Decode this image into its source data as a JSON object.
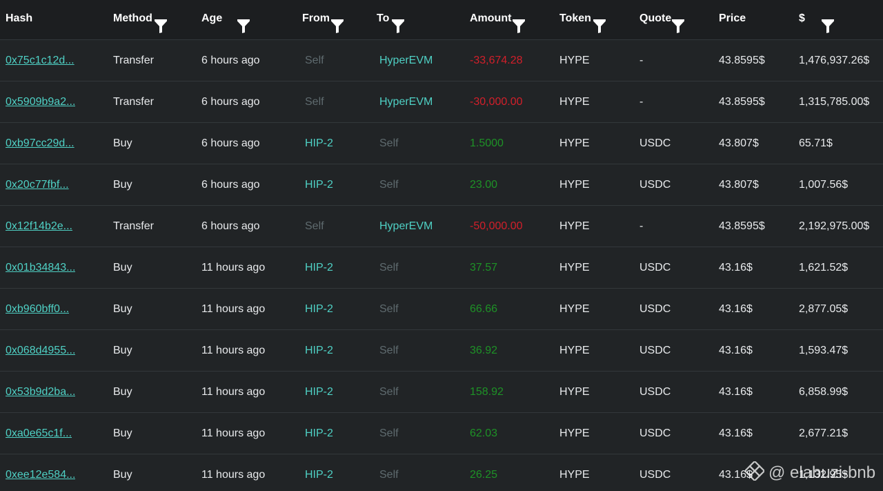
{
  "columns": {
    "hash": "Hash",
    "method": "Method",
    "age": "Age",
    "from": "From",
    "to": "To",
    "amount": "Amount",
    "token": "Token",
    "quote": "Quote",
    "price": "Price",
    "usd": "$"
  },
  "icons": {
    "filter": "filter-funnel-icon",
    "watermark_logo": "binance-diamond-icon"
  },
  "colors": {
    "link": "#4fd1c5",
    "negative": "#d21f2a",
    "positive": "#1e9226",
    "muted": "#5f6b6f"
  },
  "rows": [
    {
      "hash": "0x75c1c12d...",
      "method": "Transfer",
      "age": "6 hours ago",
      "from": "Self",
      "to": "HyperEVM",
      "amount": "-33,674.28",
      "token": "HYPE",
      "quote": "-",
      "price": "43.8595$",
      "usd": "1,476,937.26$"
    },
    {
      "hash": "0x5909b9a2...",
      "method": "Transfer",
      "age": "6 hours ago",
      "from": "Self",
      "to": "HyperEVM",
      "amount": "-30,000.00",
      "token": "HYPE",
      "quote": "-",
      "price": "43.8595$",
      "usd": "1,315,785.00$"
    },
    {
      "hash": "0xb97cc29d...",
      "method": "Buy",
      "age": "6 hours ago",
      "from": "HIP-2",
      "to": "Self",
      "amount": "1.5000",
      "token": "HYPE",
      "quote": "USDC",
      "price": "43.807$",
      "usd": "65.71$"
    },
    {
      "hash": "0x20c77fbf...",
      "method": "Buy",
      "age": "6 hours ago",
      "from": "HIP-2",
      "to": "Self",
      "amount": "23.00",
      "token": "HYPE",
      "quote": "USDC",
      "price": "43.807$",
      "usd": "1,007.56$"
    },
    {
      "hash": "0x12f14b2e...",
      "method": "Transfer",
      "age": "6 hours ago",
      "from": "Self",
      "to": "HyperEVM",
      "amount": "-50,000.00",
      "token": "HYPE",
      "quote": "-",
      "price": "43.8595$",
      "usd": "2,192,975.00$"
    },
    {
      "hash": "0x01b34843...",
      "method": "Buy",
      "age": "11 hours ago",
      "from": "HIP-2",
      "to": "Self",
      "amount": "37.57",
      "token": "HYPE",
      "quote": "USDC",
      "price": "43.16$",
      "usd": "1,621.52$"
    },
    {
      "hash": "0xb960bff0...",
      "method": "Buy",
      "age": "11 hours ago",
      "from": "HIP-2",
      "to": "Self",
      "amount": "66.66",
      "token": "HYPE",
      "quote": "USDC",
      "price": "43.16$",
      "usd": "2,877.05$"
    },
    {
      "hash": "0x068d4955...",
      "method": "Buy",
      "age": "11 hours ago",
      "from": "HIP-2",
      "to": "Self",
      "amount": "36.92",
      "token": "HYPE",
      "quote": "USDC",
      "price": "43.16$",
      "usd": "1,593.47$"
    },
    {
      "hash": "0x53b9d2ba...",
      "method": "Buy",
      "age": "11 hours ago",
      "from": "HIP-2",
      "to": "Self",
      "amount": "158.92",
      "token": "HYPE",
      "quote": "USDC",
      "price": "43.16$",
      "usd": "6,858.99$"
    },
    {
      "hash": "0xa0e65c1f...",
      "method": "Buy",
      "age": "11 hours ago",
      "from": "HIP-2",
      "to": "Self",
      "amount": "62.03",
      "token": "HYPE",
      "quote": "USDC",
      "price": "43.16$",
      "usd": "2,677.21$"
    },
    {
      "hash": "0xee12e584...",
      "method": "Buy",
      "age": "11 hours ago",
      "from": "HIP-2",
      "to": "Self",
      "amount": "26.25",
      "token": "HYPE",
      "quote": "USDC",
      "price": "43.16$",
      "usd": "1,132.95$"
    }
  ],
  "watermark": {
    "text": "@ elabuzi-bnb"
  }
}
